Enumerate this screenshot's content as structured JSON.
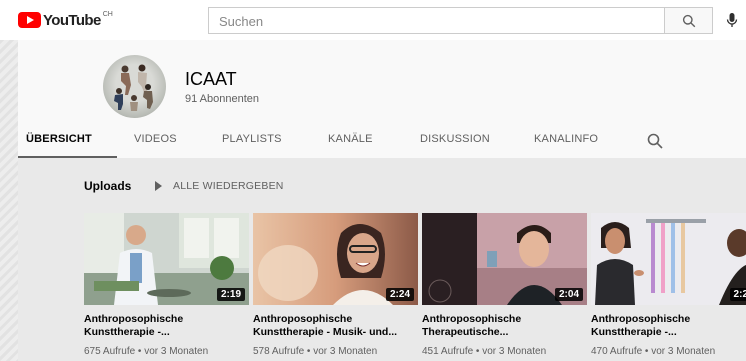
{
  "header": {
    "logo_text": "YouTube",
    "country_code": "CH",
    "search_placeholder": "Suchen"
  },
  "channel": {
    "name": "ICAAT",
    "subscribers": "91 Abonnenten"
  },
  "tabs": [
    {
      "label": "ÜBERSICHT",
      "active": true
    },
    {
      "label": "VIDEOS"
    },
    {
      "label": "PLAYLISTS"
    },
    {
      "label": "KANÄLE"
    },
    {
      "label": "DISKUSSION"
    },
    {
      "label": "KANALINFO"
    }
  ],
  "uploads": {
    "title": "Uploads",
    "play_all": "ALLE WIEDERGEBEN",
    "videos": [
      {
        "title": "Anthroposophische\nKunsttherapie -...",
        "duration": "2:19",
        "views": "675 Aufrufe",
        "age": "vor 3 Monaten"
      },
      {
        "title": "Anthroposophische\nKunsttherapie - Musik- und...",
        "duration": "2:24",
        "views": "578 Aufrufe",
        "age": "vor 3 Monaten"
      },
      {
        "title": "Anthroposophische\nTherapeutische...",
        "duration": "2:04",
        "views": "451 Aufrufe",
        "age": "vor 3 Monaten"
      },
      {
        "title": "Anthroposophische\nKunsttherapie -...",
        "duration": "2:2",
        "views": "470 Aufrufe",
        "age": "vor 3 Monaten"
      }
    ]
  },
  "colors": {
    "brand_red": "#ff0000",
    "page_bg": "#e9e9e9",
    "header_bg": "#f9f9f9"
  },
  "icons": [
    "youtube-logo-icon",
    "search-icon",
    "mic-icon",
    "tab-search-icon",
    "play-all-icon"
  ]
}
